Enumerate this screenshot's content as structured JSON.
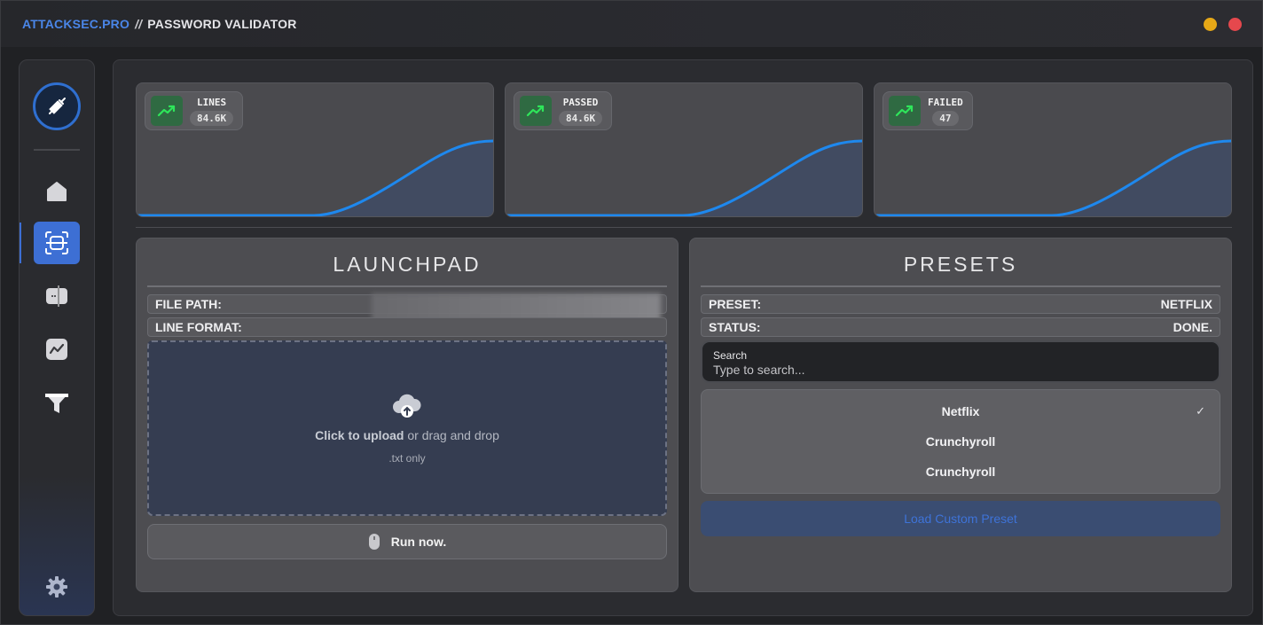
{
  "titlebar": {
    "brand": "ATTACKSEC.PRO",
    "separator": "//",
    "title": "PASSWORD VALIDATOR"
  },
  "sidebar": {
    "items": [
      {
        "name": "home",
        "icon": "home-icon"
      },
      {
        "name": "scan",
        "icon": "scan-icon",
        "active": true
      },
      {
        "name": "split",
        "icon": "split-icon"
      },
      {
        "name": "analytics",
        "icon": "chart-icon"
      },
      {
        "name": "filter",
        "icon": "filter-icon"
      }
    ],
    "settings_icon": "gear-icon"
  },
  "stats": [
    {
      "label": "LINES",
      "value": "84.6K"
    },
    {
      "label": "PASSED",
      "value": "84.6K"
    },
    {
      "label": "FAILED",
      "value": "47"
    }
  ],
  "launchpad": {
    "title": "LAUNCHPAD",
    "file_path_label": "FILE PATH:",
    "line_format_label": "LINE FORMAT:",
    "dropzone": {
      "click_text": "Click to upload",
      "rest_text": " or drag and drop",
      "hint": ".txt only"
    },
    "run_label": "Run now."
  },
  "presets": {
    "title": "PRESETS",
    "preset_label": "PRESET:",
    "preset_value": "NETFLIX",
    "status_label": "STATUS:",
    "status_value": "DONE.",
    "search_label": "Search",
    "search_placeholder": "Type to search...",
    "options": [
      "Netflix",
      "Crunchyroll",
      "Crunchyroll"
    ],
    "selected": "Netflix",
    "load_label": "Load Custom Preset"
  },
  "colors": {
    "accent": "#3d6fd4",
    "curve": "#1e88ee",
    "win_min": "#e6a817",
    "win_close": "#e5484d"
  }
}
